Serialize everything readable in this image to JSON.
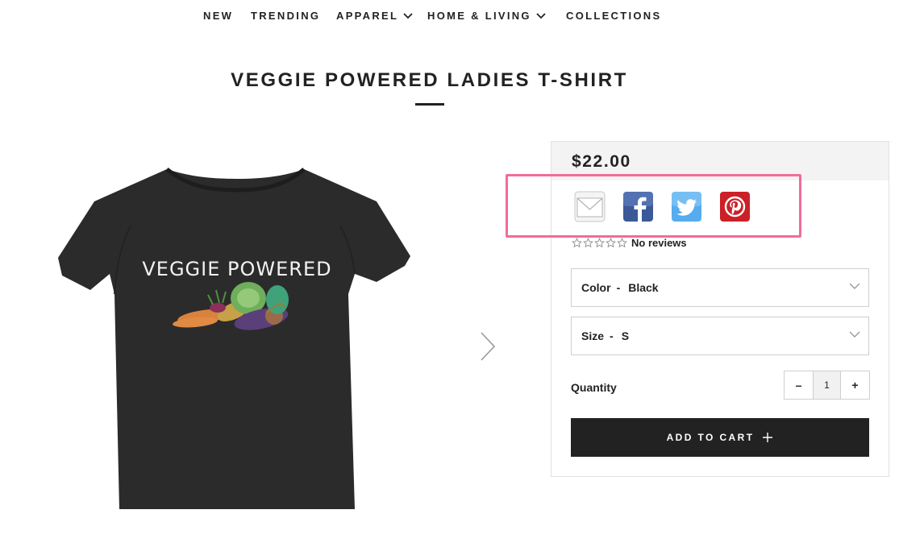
{
  "nav": {
    "items": [
      {
        "label": "NEW",
        "has_dropdown": false
      },
      {
        "label": "TRENDING",
        "has_dropdown": false
      },
      {
        "label": "APPAREL",
        "has_dropdown": true
      },
      {
        "label": "HOME & LIVING",
        "has_dropdown": true
      },
      {
        "label": "COLLECTIONS",
        "has_dropdown": false
      }
    ]
  },
  "product": {
    "title": "VEGGIE POWERED LADIES T-SHIRT",
    "image_text": "VEGGIE POWERED",
    "price": "$22.00",
    "share_icons": [
      "email-icon",
      "facebook-icon",
      "twitter-icon",
      "pinterest-icon"
    ],
    "reviews": {
      "rating": 0,
      "max": 5,
      "text": "No reviews"
    },
    "options": [
      {
        "label": "Color",
        "separator": "-",
        "value": "Black"
      },
      {
        "label": "Size",
        "separator": "-",
        "value": "S"
      }
    ],
    "quantity": {
      "label": "Quantity",
      "decrement": "–",
      "value": "1",
      "increment": "+"
    },
    "add_to_cart": "ADD TO CART"
  },
  "colors": {
    "accent_highlight": "#f06b9d",
    "button_dark": "#222222",
    "price_bar": "#f3f3f3",
    "facebook": "#3b5998",
    "twitter": "#55acee",
    "pinterest": "#cb2027"
  }
}
